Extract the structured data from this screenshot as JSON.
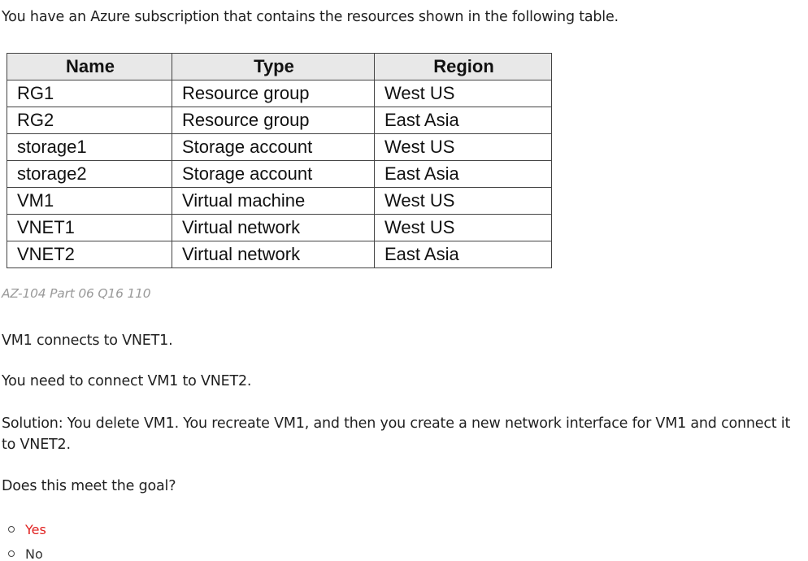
{
  "intro": "You have an Azure subscription that contains the resources shown in the following table.",
  "table": {
    "headers": [
      "Name",
      "Type",
      "Region"
    ],
    "rows": [
      [
        "RG1",
        "Resource group",
        "West US"
      ],
      [
        "RG2",
        "Resource group",
        "East Asia"
      ],
      [
        "storage1",
        "Storage account",
        "West US"
      ],
      [
        "storage2",
        "Storage account",
        "East Asia"
      ],
      [
        "VM1",
        "Virtual machine",
        "West US"
      ],
      [
        "VNET1",
        "Virtual network",
        "West US"
      ],
      [
        "VNET2",
        "Virtual network",
        "East Asia"
      ]
    ]
  },
  "caption": "AZ-104 Part 06 Q16 110",
  "paragraphs": [
    "VM1 connects to VNET1.",
    "You need to connect VM1 to VNET2.",
    "Solution: You delete VM1. You recreate VM1, and then you create a new network interface for VM1 and connect it to VNET2."
  ],
  "question": "Does this meet the goal?",
  "options": [
    {
      "label": "Yes",
      "color": "#e0201f"
    },
    {
      "label": "No",
      "color": "#333333"
    }
  ]
}
